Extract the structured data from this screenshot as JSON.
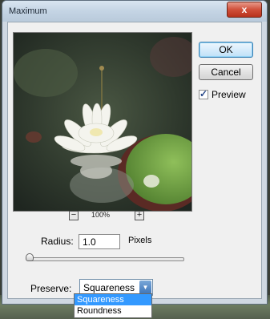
{
  "window": {
    "title": "Maximum",
    "close_glyph": "x"
  },
  "buttons": {
    "ok_label": "OK",
    "cancel_label": "Cancel"
  },
  "preview_option": {
    "label": "Preview",
    "checked": true
  },
  "zoom": {
    "level": "100%",
    "minus_glyph": "−",
    "plus_glyph": "+"
  },
  "radius": {
    "label": "Radius:",
    "value": "1.0",
    "units": "Pixels",
    "slider_fraction": 0.01
  },
  "preserve": {
    "label": "Preserve:",
    "selected": "Squareness",
    "options": [
      "Squareness",
      "Roundness"
    ],
    "highlighted": "Squareness"
  },
  "icons": {
    "close": "close-icon",
    "zoom_out": "zoom-out-icon",
    "zoom_in": "zoom-in-icon",
    "check": "check-icon",
    "dropdown": "chevron-down-icon"
  },
  "colors": {
    "dialog_bg": "#f0f0f0",
    "frame": "#cfd8e2",
    "ok_border": "#3c7fb1",
    "close_red": "#c8452f",
    "highlight": "#3399ff"
  }
}
